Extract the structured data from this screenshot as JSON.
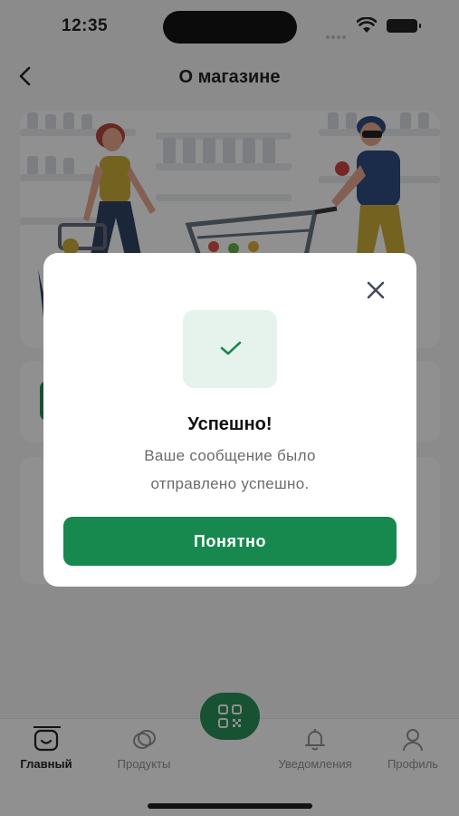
{
  "status_bar": {
    "time": "12:35"
  },
  "header": {
    "title": "О магазине",
    "back_icon": "chevron-left-icon"
  },
  "modal": {
    "title": "Успешно!",
    "message_line1": "Ваше сообщение было",
    "message_line2": "отправлено успешно.",
    "button_label": "Понятно",
    "close_icon": "close-icon",
    "status_icon": "check-icon"
  },
  "tabbar": {
    "items": [
      {
        "label": "Главный",
        "icon": "home-icon",
        "active": true
      },
      {
        "label": "Продукты",
        "icon": "products-icon",
        "active": false
      },
      {
        "label": "Уведомления",
        "icon": "bell-icon",
        "active": false
      },
      {
        "label": "Профиль",
        "icon": "user-icon",
        "active": false
      }
    ],
    "center_icon": "qr-code-icon"
  },
  "colors": {
    "accent": "#17894e",
    "accent_light": "#e6f3ec",
    "overlay": "rgba(24,24,24,0.48)",
    "muted_text": "#6b6b6b"
  }
}
